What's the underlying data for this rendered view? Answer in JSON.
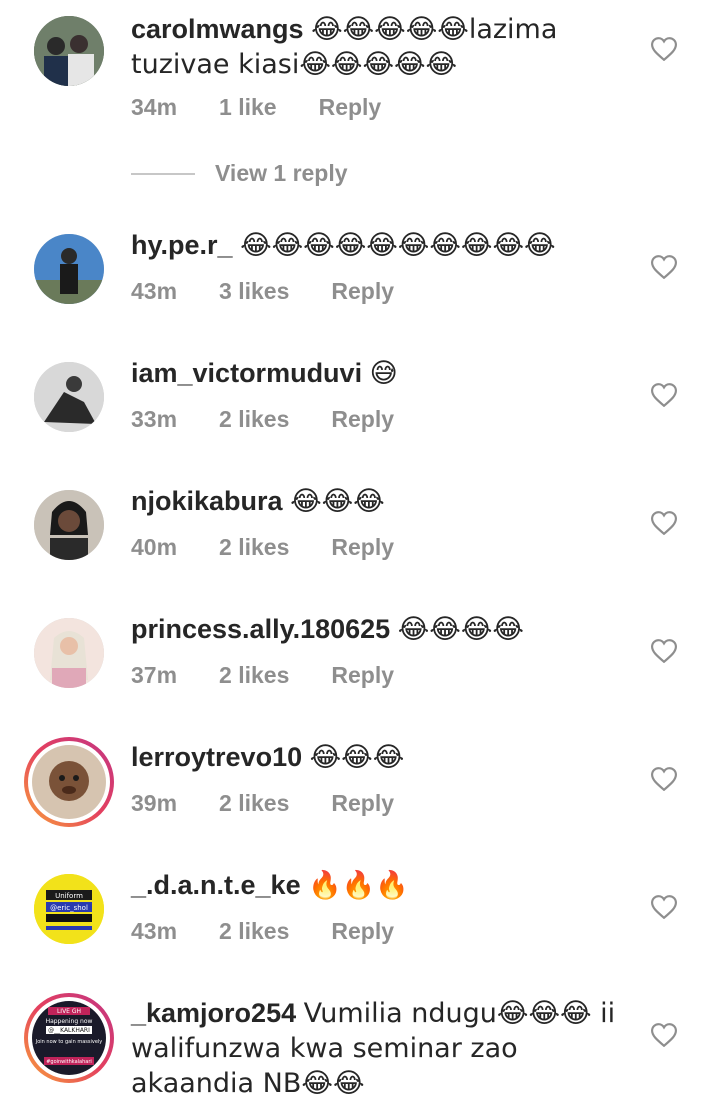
{
  "comments": [
    {
      "user": "carolmwangs",
      "text": "😂😂😂😂😂lazima tuzivae kiasi😂😂😂😂😂",
      "time": "34m",
      "likes": "1 like",
      "reply": "Reply",
      "avatar_color": "#4a5a46"
    },
    {
      "user": "hy.pe.r_",
      "text": "😂😂😂😂😂😂😂😂😂😂",
      "time": "43m",
      "likes": "3 likes",
      "reply": "Reply",
      "avatar_color": "#3d6fa8"
    },
    {
      "user": "iam_victormuduvi",
      "text": "😅",
      "time": "33m",
      "likes": "2 likes",
      "reply": "Reply",
      "avatar_color": "#9a9a9a"
    },
    {
      "user": "njokikabura",
      "text": "😂😂😂",
      "time": "40m",
      "likes": "2 likes",
      "reply": "Reply",
      "avatar_color": "#6b4a3a"
    },
    {
      "user": "princess.ally.180625",
      "text": "😂😂😂😂",
      "time": "37m",
      "likes": "2 likes",
      "reply": "Reply",
      "avatar_color": "#e8c8c0"
    },
    {
      "user": "lerroytrevo10",
      "text": "😂😂😂",
      "time": "39m",
      "likes": "2 likes",
      "reply": "Reply",
      "avatar_color": "#8a6a50"
    },
    {
      "user": "_.d.a.n.t.e_ke",
      "text": "🔥🔥🔥",
      "time": "43m",
      "likes": "2 likes",
      "reply": "Reply",
      "avatar_color": "#f2e21a"
    },
    {
      "user": "_kamjoro254",
      "text": "Vumilia ndugu😂😂😂 ii walifunzwa kwa seminar zao akaandia NB😂😂",
      "time": "",
      "likes": "",
      "reply": "",
      "avatar_color": "#c0235a"
    }
  ],
  "view_replies": "View 1 reply",
  "avatar_texts": {
    "dante": [
      "Uniform",
      "@eric_shol"
    ],
    "kamjoro": [
      "LIVE GH",
      "Happening now",
      "@__KALKHARI",
      "Join now to gain massively",
      "#goinwithkalahari"
    ]
  }
}
